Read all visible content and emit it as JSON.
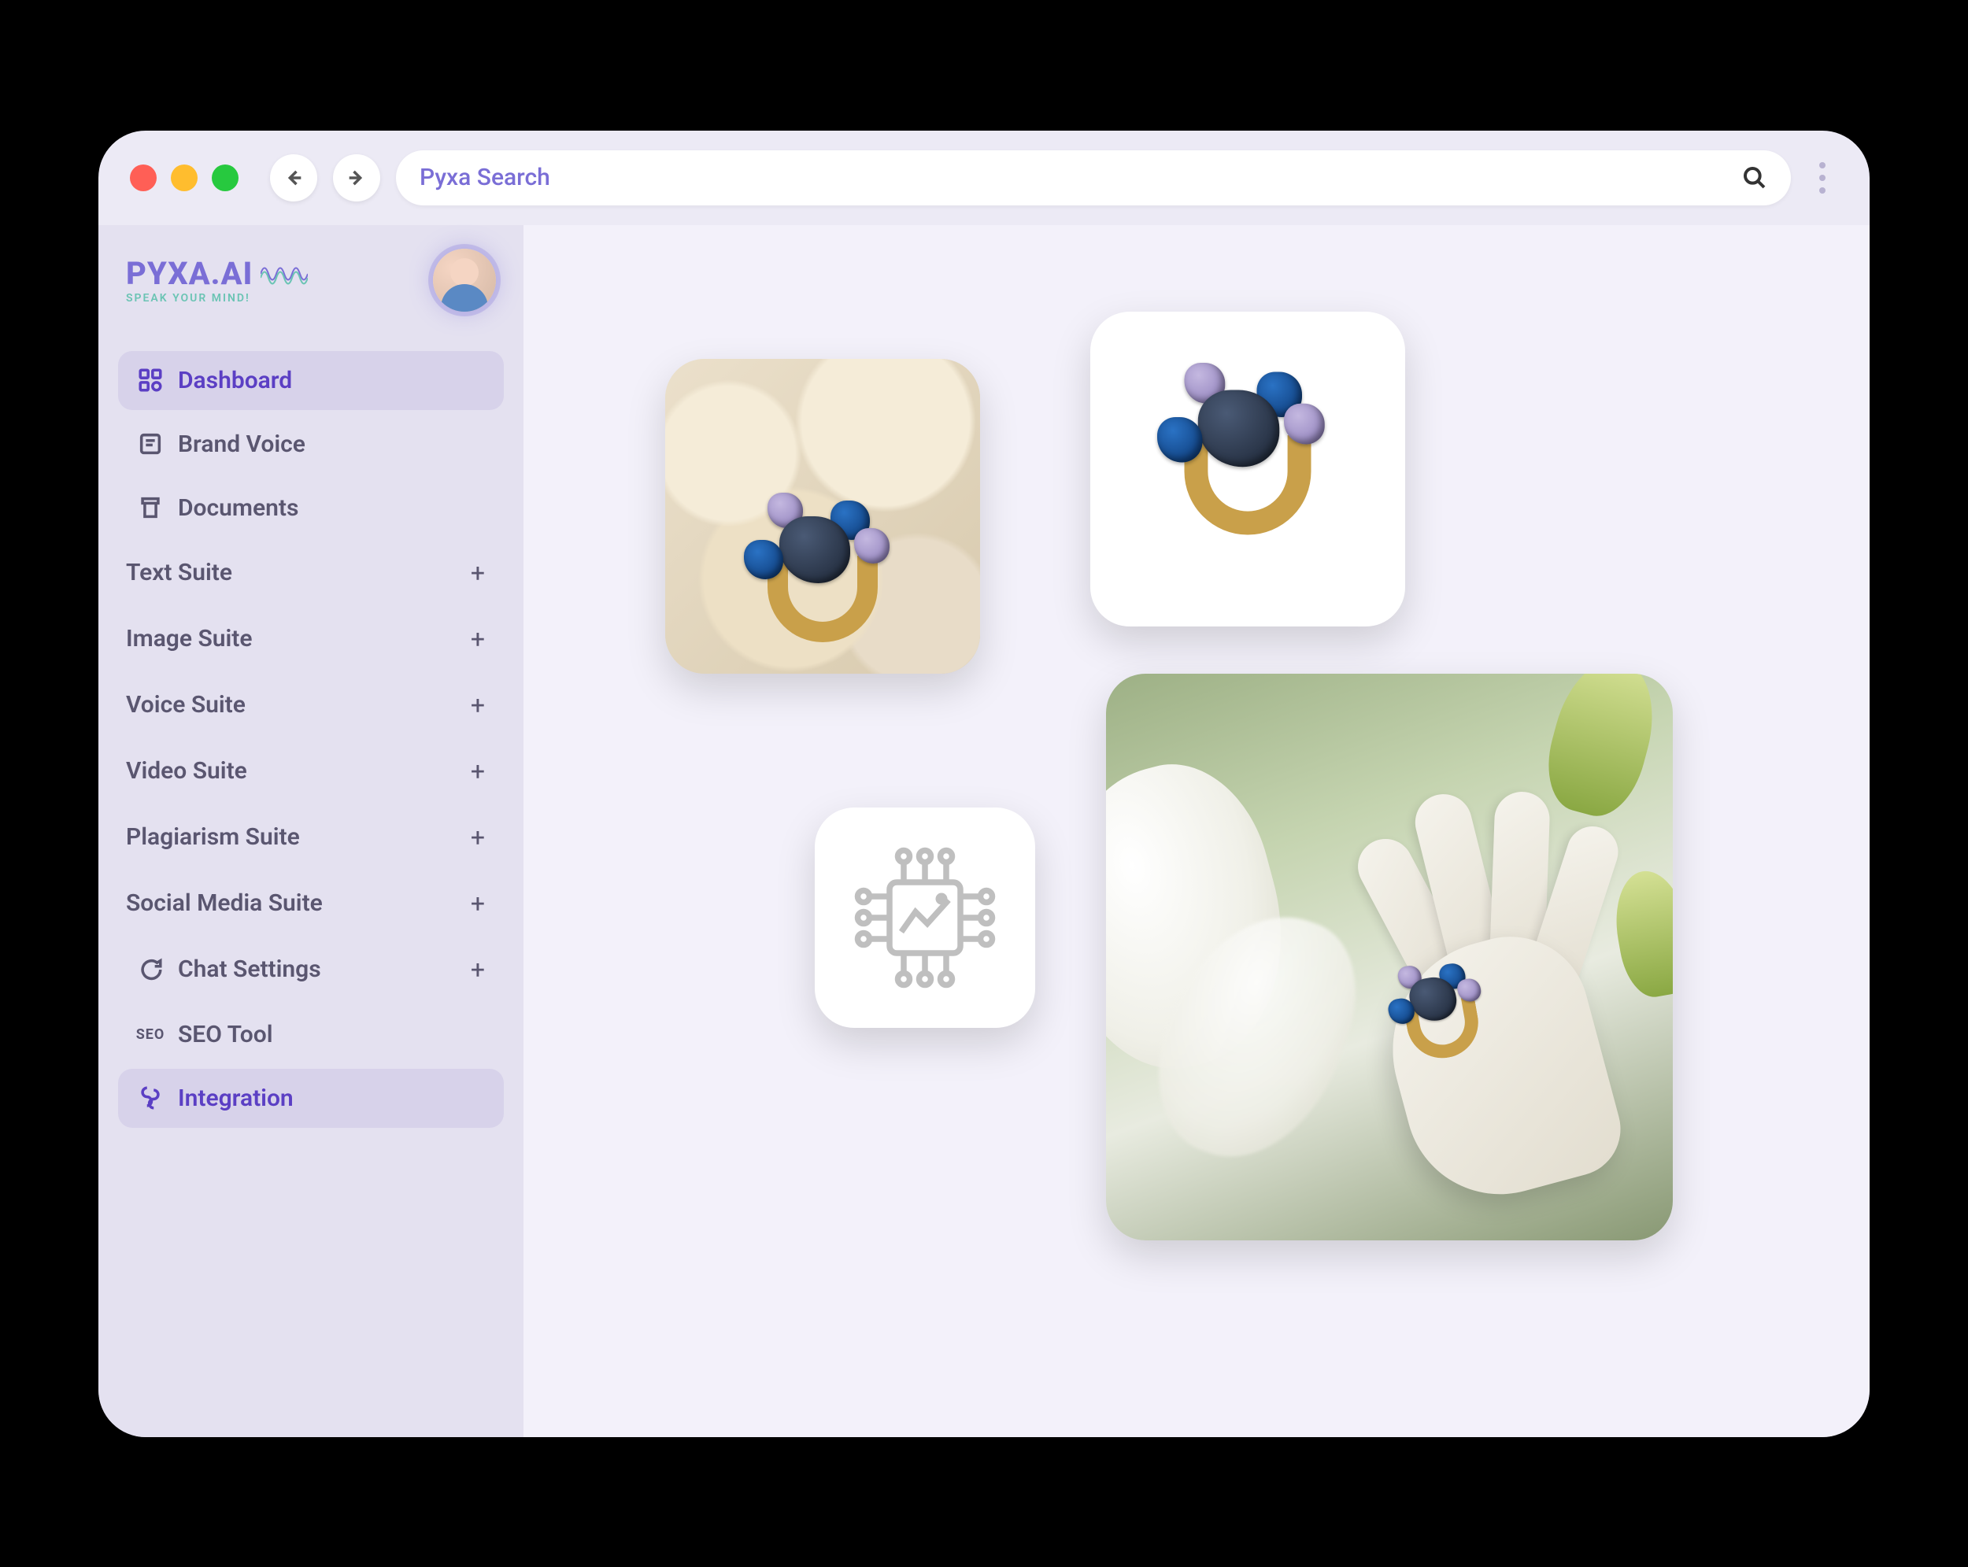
{
  "browser": {
    "search_placeholder": "Pyxa Search"
  },
  "logo": {
    "name": "PYXA.AI",
    "tagline": "SPEAK YOUR MIND!"
  },
  "sidebar": {
    "items": [
      {
        "label": "Dashboard"
      },
      {
        "label": "Brand Voice"
      },
      {
        "label": "Documents"
      },
      {
        "label": "Text Suite"
      },
      {
        "label": "Image Suite"
      },
      {
        "label": "Voice Suite"
      },
      {
        "label": "Video Suite"
      },
      {
        "label": "Plagiarism Suite"
      },
      {
        "label": "Social Media Suite"
      },
      {
        "label": "Chat Settings"
      },
      {
        "label": "SEO Tool"
      },
      {
        "label": "Integration"
      }
    ],
    "seo_badge": "SEO",
    "expand_glyph": "+"
  }
}
